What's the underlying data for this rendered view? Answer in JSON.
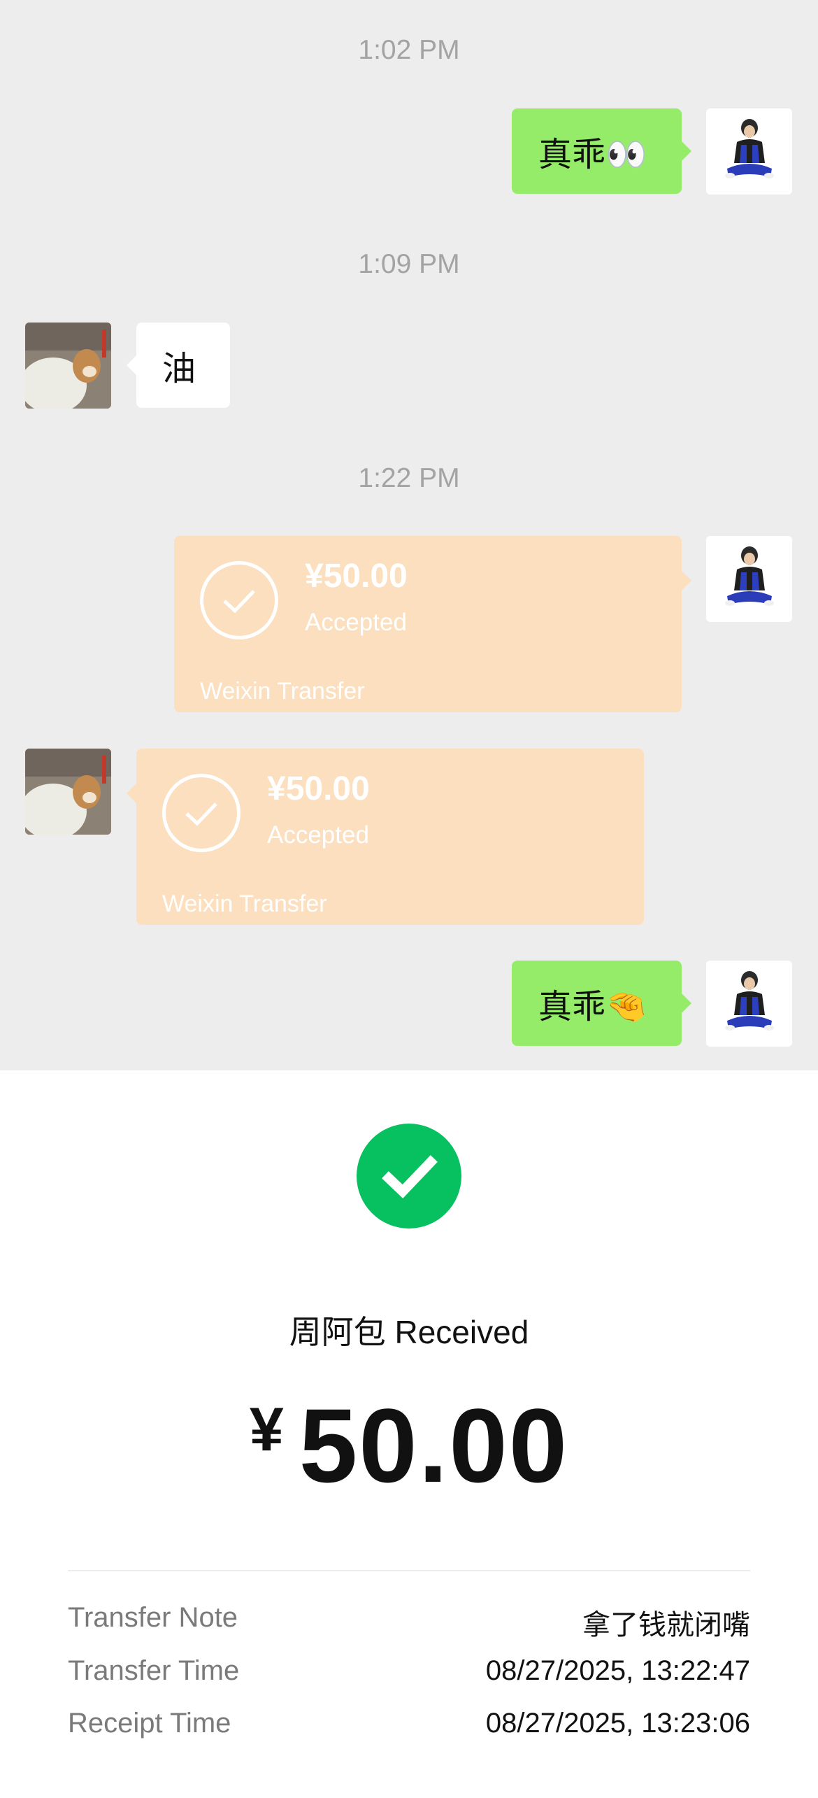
{
  "chat": {
    "timestamps": [
      "1:02 PM",
      "1:09 PM",
      "1:22 PM"
    ],
    "messages": {
      "m1_text": "真乖👀",
      "m2_text": "油",
      "m5_text": "真乖🤏"
    },
    "transfer_sent": {
      "amount": "¥50.00",
      "status": "Accepted",
      "brand": "Weixin Transfer"
    },
    "transfer_received": {
      "amount": "¥50.00",
      "status": "Accepted",
      "brand": "Weixin Transfer"
    },
    "colors": {
      "chat_background": "#ededed",
      "sent_bubble": "#95ec69",
      "transfer_card": "#fcdfbf"
    }
  },
  "receipt": {
    "icon": "check-circle-icon",
    "title": "周阿包 Received",
    "currency_symbol": "¥",
    "amount": "50.00",
    "rows": [
      {
        "label": "Transfer Note",
        "value": "拿了钱就闭嘴"
      },
      {
        "label": "Transfer Time",
        "value": "08/27/2025, 13:22:47"
      },
      {
        "label": "Receipt Time",
        "value": "08/27/2025, 13:23:06"
      }
    ],
    "colors": {
      "success": "#07c160"
    }
  }
}
